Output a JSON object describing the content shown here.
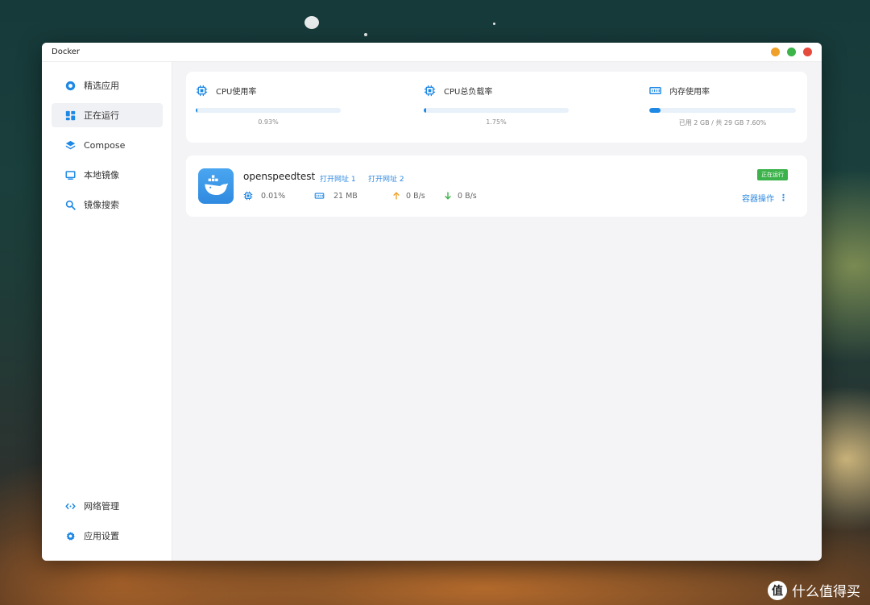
{
  "window": {
    "title": "Docker",
    "traffic_colors": {
      "minimize": "#f0a028",
      "maximize": "#3cb44a",
      "close": "#e64a3c"
    }
  },
  "sidebar": {
    "items": [
      {
        "label": "精选应用",
        "icon": "compass-icon"
      },
      {
        "label": "正在运行",
        "icon": "dashboard-icon",
        "active": true
      },
      {
        "label": "Compose",
        "icon": "layers-icon"
      },
      {
        "label": "本地镜像",
        "icon": "monitor-icon"
      },
      {
        "label": "镜像搜索",
        "icon": "search-icon"
      }
    ],
    "bottom_items": [
      {
        "label": "网络管理",
        "icon": "network-icon"
      },
      {
        "label": "应用设置",
        "icon": "gear-icon"
      }
    ]
  },
  "stats": {
    "cpu_usage": {
      "label": "CPU使用率",
      "value": "0.93%",
      "fraction": 0.0093
    },
    "cpu_load": {
      "label": "CPU总负载率",
      "value": "1.75%",
      "fraction": 0.0175
    },
    "memory": {
      "label": "内存使用率",
      "value": "已用 2 GB / 共 29 GB  7.60%",
      "fraction": 0.076
    }
  },
  "container": {
    "name": "openspeedtest",
    "link1": "打开网址 1",
    "link2": "打开网址 2",
    "cpu": "0.01%",
    "memory": "21 MB",
    "upload": "0 B/s",
    "download": "0 B/s",
    "status": "正在运行",
    "ops_label": "容器操作"
  },
  "watermark": {
    "logo": "值",
    "text": "什么值得买"
  },
  "colors": {
    "accent": "#1e88e5",
    "link": "#2f8ae0",
    "running": "#3bb24a",
    "upload_arrow": "#f0a028",
    "download_arrow": "#3bb24a"
  }
}
